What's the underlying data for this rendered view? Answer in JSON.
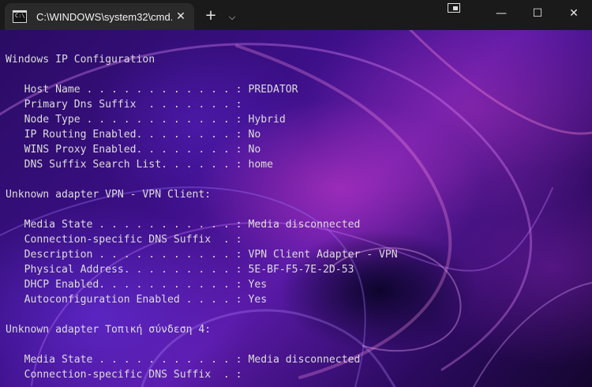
{
  "titlebar": {
    "tab_icon_text": "C:\\",
    "tab_title": "C:\\WINDOWS\\system32\\cmd.",
    "tab_close_glyph": "✕",
    "new_tab_glyph": "+",
    "dropdown_glyph": "⌵",
    "minimize_glyph": "—",
    "maximize_glyph": "☐",
    "close_glyph": "✕"
  },
  "colors": {
    "titlebar_bg": "#1a1a1a",
    "tab_bg": "#2a2a2a",
    "console_text": "#dcdcdc",
    "background_accent": "#7b2ff7"
  },
  "console": {
    "lines": [
      "",
      "Windows IP Configuration",
      "",
      "   Host Name . . . . . . . . . . . . : PREDATOR",
      "   Primary Dns Suffix  . . . . . . . :",
      "   Node Type . . . . . . . . . . . . : Hybrid",
      "   IP Routing Enabled. . . . . . . . : No",
      "   WINS Proxy Enabled. . . . . . . . : No",
      "   DNS Suffix Search List. . . . . . : home",
      "",
      "Unknown adapter VPN - VPN Client:",
      "",
      "   Media State . . . . . . . . . . . : Media disconnected",
      "   Connection-specific DNS Suffix  . :",
      "   Description . . . . . . . . . . . : VPN Client Adapter - VPN",
      "   Physical Address. . . . . . . . . : 5E-BF-F5-7E-2D-53",
      "   DHCP Enabled. . . . . . . . . . . : Yes",
      "   Autoconfiguration Enabled . . . . : Yes",
      "",
      "Unknown adapter Τοπική σύνδεση 4:",
      "",
      "   Media State . . . . . . . . . . . : Media disconnected",
      "   Connection-specific DNS Suffix  . :"
    ]
  }
}
